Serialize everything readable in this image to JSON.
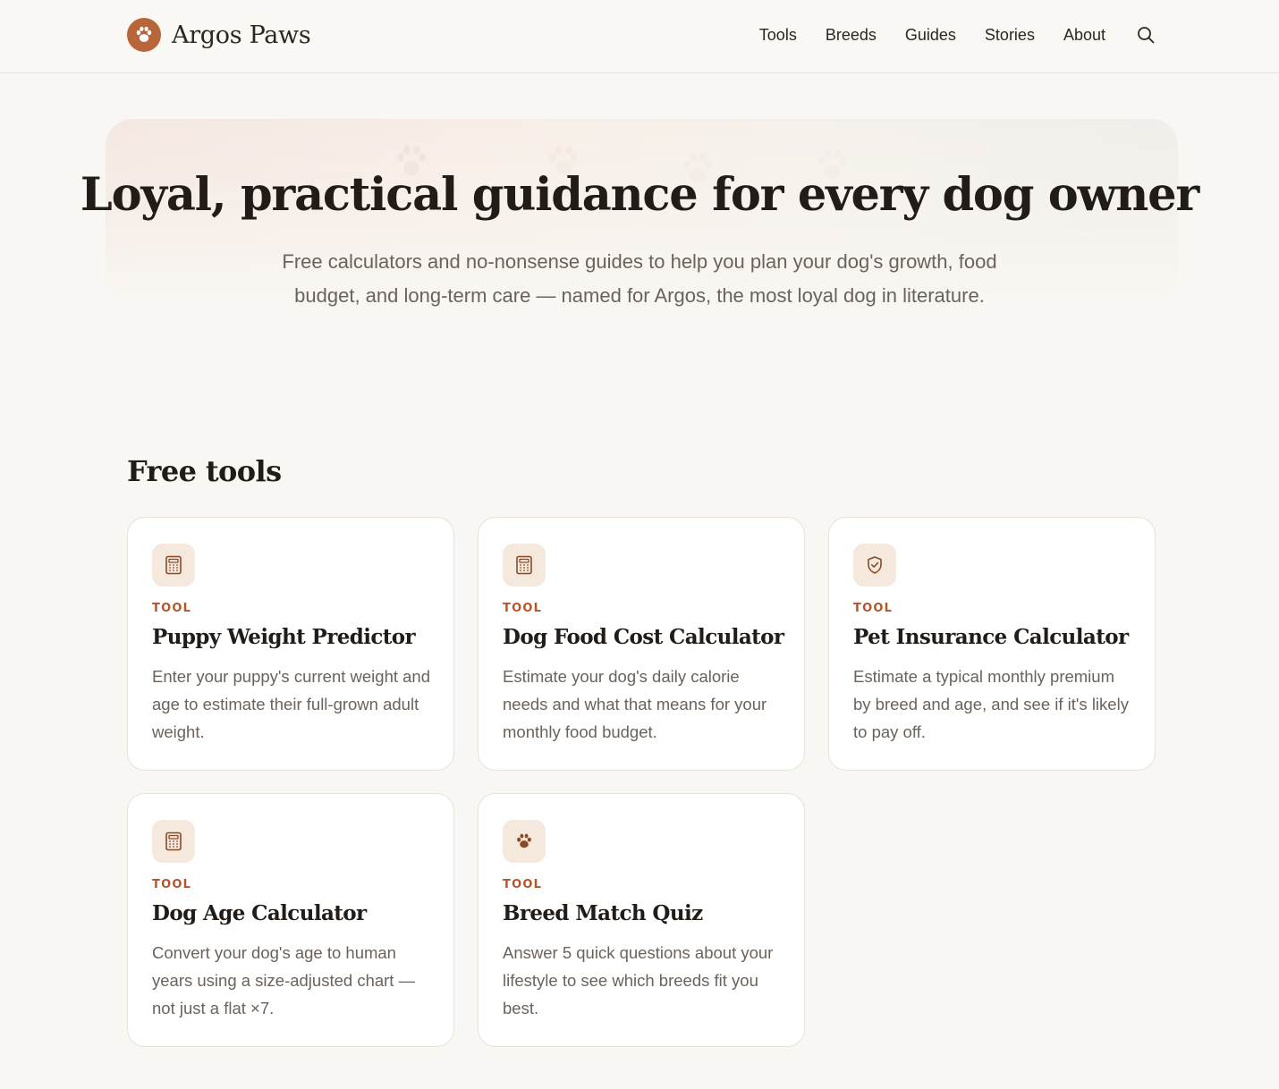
{
  "header": {
    "brand": "Argos Paws",
    "nav": [
      "Tools",
      "Breeds",
      "Guides",
      "Stories",
      "About"
    ]
  },
  "hero": {
    "title": "Loyal, practical guidance for every dog owner",
    "subtitle": "Free calculators and no-nonsense guides to help you plan your dog's growth, food budget, and long-term care — named for Argos, the most loyal dog in literature."
  },
  "tools_section": {
    "heading": "Free tools",
    "cards": [
      {
        "icon": "calculator-icon",
        "kicker": "TOOL",
        "title": "Puppy Weight Predictor",
        "description": "Enter your puppy's current weight and age to estimate their full-grown adult weight."
      },
      {
        "icon": "calculator-icon",
        "kicker": "TOOL",
        "title": "Dog Food Cost Calculator",
        "description": "Estimate your dog's daily calorie needs and what that means for your monthly food budget."
      },
      {
        "icon": "shield-check-icon",
        "kicker": "TOOL",
        "title": "Pet Insurance Calculator",
        "description": "Estimate a typical monthly premium by breed and age, and see if it's likely to pay off."
      },
      {
        "icon": "calculator-icon",
        "kicker": "TOOL",
        "title": "Dog Age Calculator",
        "description": "Convert your dog's age to human years using a size-adjusted chart — not just a flat ×7."
      },
      {
        "icon": "paw-icon",
        "kicker": "TOOL",
        "title": "Breed Match Quiz",
        "description": "Answer 5 quick questions about your lifestyle to see which breeds fit you best."
      }
    ]
  },
  "colors": {
    "accent": "#b9653a",
    "kicker": "#b2552b",
    "background": "#f9f7f3",
    "icon_bg": "#f5e8dc"
  }
}
